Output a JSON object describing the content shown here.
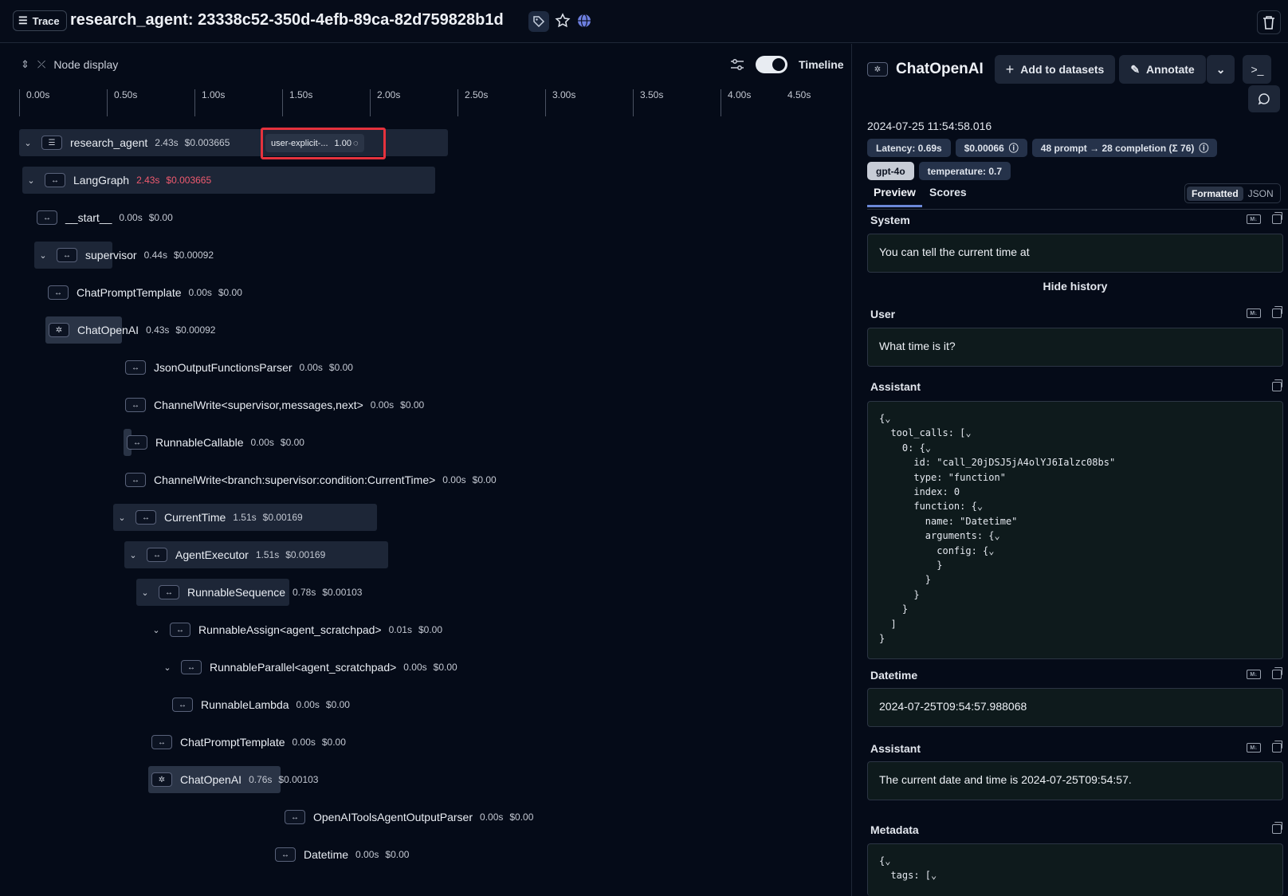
{
  "header": {
    "trace_label": "Trace",
    "title": "research_agent: 23338c52-350d-4efb-89ca-82d759828b1d"
  },
  "left": {
    "node_display": "Node display",
    "timeline_label": "Timeline",
    "ticks": [
      "0.00s",
      "0.50s",
      "1.00s",
      "1.50s",
      "2.00s",
      "2.50s",
      "3.00s",
      "3.50s",
      "4.00s",
      "4.50s"
    ],
    "feedback": {
      "key": "user-explicit-...",
      "score": "1.00"
    },
    "runs": [
      {
        "name": "research_agent",
        "dur": "2.43s",
        "cost": "$0.003665"
      },
      {
        "name": "LangGraph",
        "dur": "2.43s",
        "cost": "$0.003665"
      },
      {
        "name": "__start__",
        "dur": "0.00s",
        "cost": "$0.00"
      },
      {
        "name": "supervisor",
        "dur": "0.44s",
        "cost": "$0.00092"
      },
      {
        "name": "ChatPromptTemplate",
        "dur": "0.00s",
        "cost": "$0.00"
      },
      {
        "name": "ChatOpenAI",
        "dur": "0.43s",
        "cost": "$0.00092"
      },
      {
        "name": "JsonOutputFunctionsParser",
        "dur": "0.00s",
        "cost": "$0.00"
      },
      {
        "name": "ChannelWrite<supervisor,messages,next>",
        "dur": "0.00s",
        "cost": "$0.00"
      },
      {
        "name": "RunnableCallable",
        "dur": "0.00s",
        "cost": "$0.00"
      },
      {
        "name": "ChannelWrite<branch:supervisor:condition:CurrentTime>",
        "dur": "0.00s",
        "cost": "$0.00"
      },
      {
        "name": "CurrentTime",
        "dur": "1.51s",
        "cost": "$0.00169"
      },
      {
        "name": "AgentExecutor",
        "dur": "1.51s",
        "cost": "$0.00169"
      },
      {
        "name": "RunnableSequence",
        "dur": "0.78s",
        "cost": "$0.00103"
      },
      {
        "name": "RunnableAssign<agent_scratchpad>",
        "dur": "0.01s",
        "cost": "$0.00"
      },
      {
        "name": "RunnableParallel<agent_scratchpad>",
        "dur": "0.00s",
        "cost": "$0.00"
      },
      {
        "name": "RunnableLambda",
        "dur": "0.00s",
        "cost": "$0.00"
      },
      {
        "name": "ChatPromptTemplate",
        "dur": "0.00s",
        "cost": "$0.00"
      },
      {
        "name": "ChatOpenAI",
        "dur": "0.76s",
        "cost": "$0.00103"
      },
      {
        "name": "OpenAIToolsAgentOutputParser",
        "dur": "0.00s",
        "cost": "$0.00"
      },
      {
        "name": "Datetime",
        "dur": "0.00s",
        "cost": "$0.00"
      }
    ]
  },
  "right": {
    "title": "ChatOpenAI",
    "add_to_datasets": "Add to datasets",
    "annotate": "Annotate",
    "timestamp": "2024-07-25 11:54:58.016",
    "latency": "Latency: 0.69s",
    "cost": "$0.00066",
    "tokens": "48 prompt → 28 completion (Σ 76)",
    "model": "gpt-4o",
    "temperature": "temperature: 0.7",
    "tab_preview": "Preview",
    "tab_scores": "Scores",
    "formatted": "Formatted",
    "json": "JSON",
    "system_label": "System",
    "system_text": "You can tell the current time at",
    "hide_history": "Hide history",
    "user_label": "User",
    "user_text": "What time is it?",
    "assistant_label": "Assistant",
    "assistant_code": "{⌄\n  tool_calls: [⌄\n    0: {⌄\n      id: \"call_20jDSJ5jA4olYJ6Ialzc08bs\"\n      type: \"function\"\n      index: 0\n      function: {⌄\n        name: \"Datetime\"\n        arguments: {⌄\n          config: {⌄\n          }\n        }\n      }\n    }\n  ]\n}",
    "datetime_label": "Datetime",
    "datetime_text": "2024-07-25T09:54:57.988068",
    "assistant2_label": "Assistant",
    "assistant2_text": "The current date and time is 2024-07-25T09:54:57.",
    "metadata_label": "Metadata",
    "metadata_code": "{⌄\n  tags: [⌄"
  }
}
